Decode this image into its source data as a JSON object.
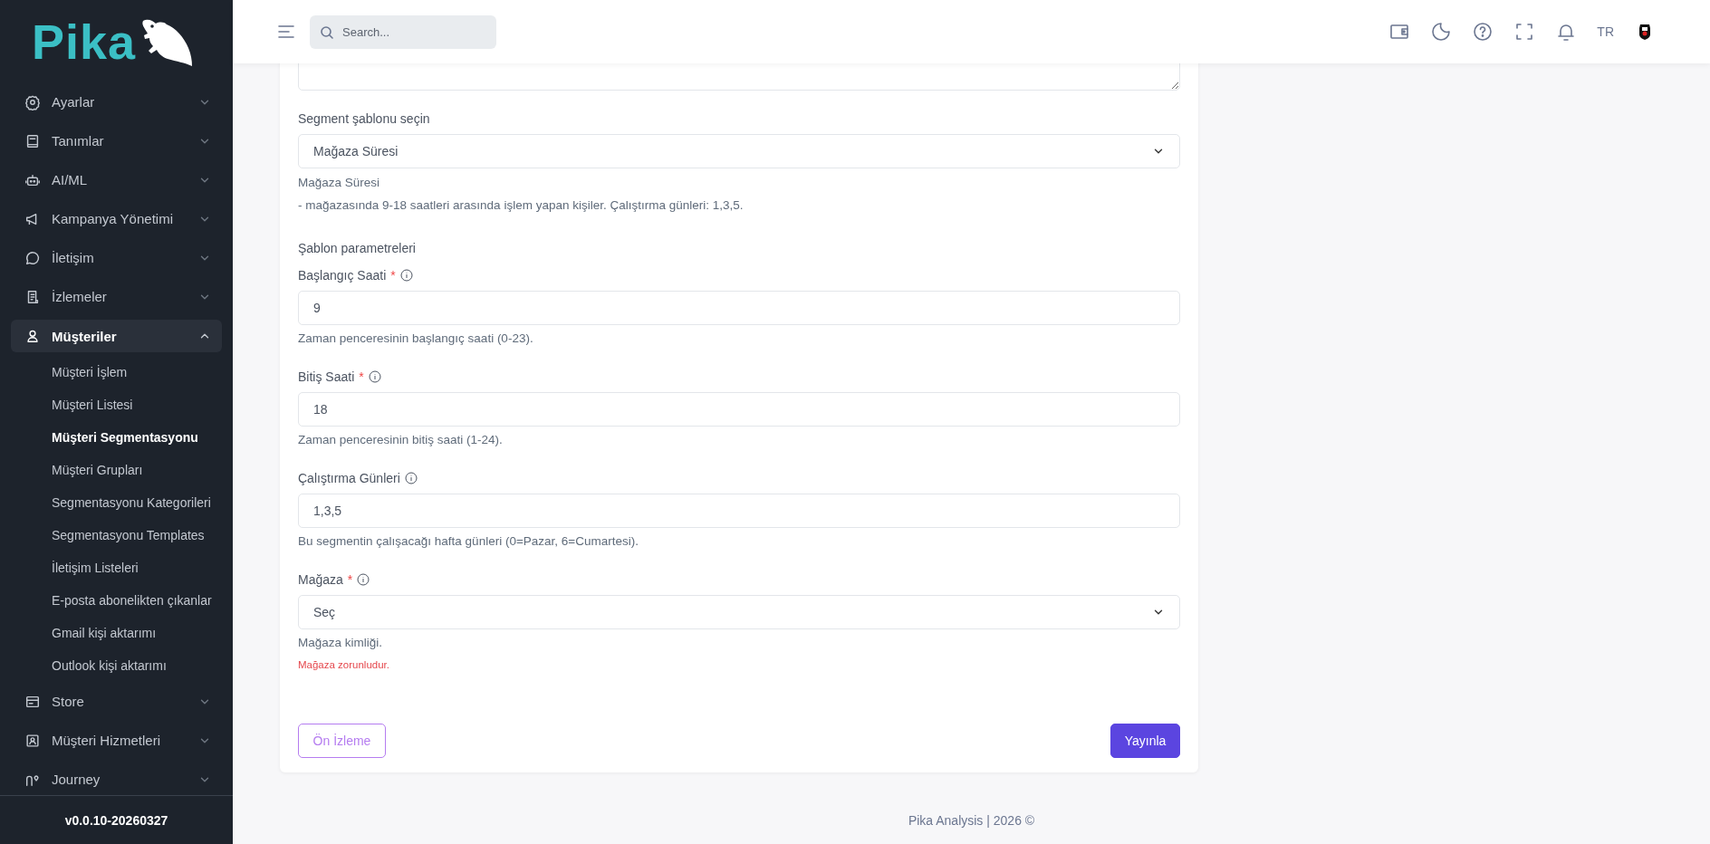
{
  "logo": {
    "text": "Pika"
  },
  "sidebar": {
    "items": [
      {
        "label": "Ayarlar",
        "selected": false,
        "expanded": false
      },
      {
        "label": "Tanımlar",
        "selected": false,
        "expanded": false
      },
      {
        "label": "AI/ML",
        "selected": false,
        "expanded": false
      },
      {
        "label": "Kampanya Yönetimi",
        "selected": false,
        "expanded": false
      },
      {
        "label": "İletişim",
        "selected": false,
        "expanded": false
      },
      {
        "label": "İzlemeler",
        "selected": false,
        "expanded": false
      },
      {
        "label": "Müşteriler",
        "selected": true,
        "expanded": true,
        "children": [
          {
            "label": "Müşteri İşlem",
            "selected": false
          },
          {
            "label": "Müşteri Listesi",
            "selected": false
          },
          {
            "label": "Müşteri Segmentasyonu",
            "selected": true
          },
          {
            "label": "Müşteri Grupları",
            "selected": false
          },
          {
            "label": "Segmentasyonu Kategorileri",
            "selected": false
          },
          {
            "label": "Segmentasyonu Templates",
            "selected": false
          },
          {
            "label": "İletişim Listeleri",
            "selected": false
          },
          {
            "label": "E-posta abonelikten çıkanlar",
            "selected": false
          },
          {
            "label": "Gmail kişi aktarımı",
            "selected": false
          },
          {
            "label": "Outlook kişi aktarımı",
            "selected": false
          }
        ]
      },
      {
        "label": "Store",
        "selected": false,
        "expanded": false
      },
      {
        "label": "Müşteri Hizmetleri",
        "selected": false,
        "expanded": false
      },
      {
        "label": "Journey",
        "selected": false,
        "expanded": false
      }
    ],
    "version": "v0.0.10-20260327"
  },
  "header": {
    "search": {
      "placeholder": "Search..."
    },
    "language": "TR"
  },
  "form": {
    "template_select": {
      "label": "Segment şablonu seçin",
      "value": "Mağaza Süresi"
    },
    "template_description": [
      "Mağaza Süresi",
      "- mağazasında 9-18 saatleri arasında işlem yapan kişiler. Çalıştırma günleri: 1,3,5."
    ],
    "section_title": "Şablon parametreleri",
    "fields": [
      {
        "kind": "input",
        "label": "Başlangıç Saati",
        "required_mark": "*",
        "value": "9",
        "help": "Zaman penceresinin başlangıç saati (0-23)."
      },
      {
        "kind": "input",
        "label": "Bitiş Saati",
        "required_mark": "*",
        "value": "18",
        "help": "Zaman penceresinin bitiş saati (1-24)."
      },
      {
        "kind": "input",
        "label": "Çalıştırma Günleri",
        "value": "1,3,5",
        "help": "Bu segmentin çalışacağı hafta günleri (0=Pazar, 6=Cumartesi)."
      },
      {
        "kind": "select",
        "label": "Mağaza",
        "required_mark": "*",
        "value": "Seç",
        "help": "Mağaza kimliği.",
        "error": "Mağaza zorunludur."
      }
    ],
    "buttons": [
      {
        "label": "Ön İzleme",
        "kind": "outline"
      },
      {
        "label": "Yayınla",
        "kind": "primary"
      }
    ]
  },
  "footer": {
    "text": "Pika Analysis | 2026 ©"
  }
}
